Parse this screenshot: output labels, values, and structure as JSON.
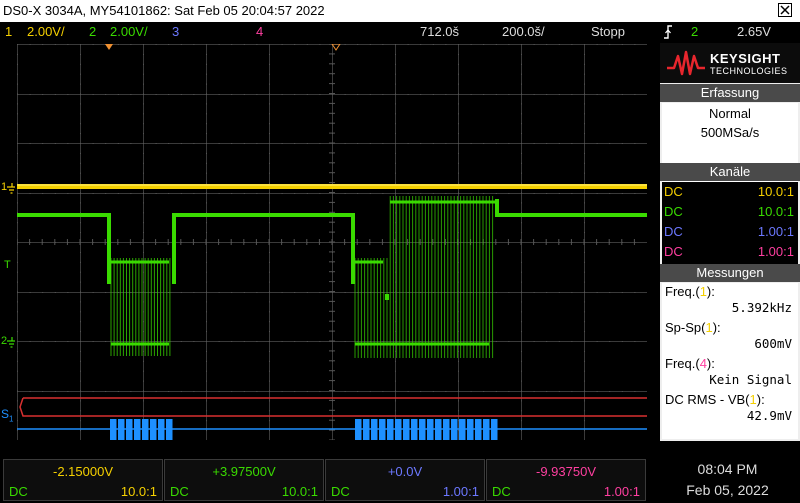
{
  "window": {
    "title": "DS0-X 3034A, MY54101862: Sat Feb 05 20:04:57 2022"
  },
  "status_bar": {
    "ch1_num": "1",
    "ch1_scale": "2.00V/",
    "ch2_num": "2",
    "ch2_scale": "2.00V/",
    "ch3_num": "3",
    "ch4_num": "4",
    "time_delay": "712.0š",
    "time_scale": "200.0š/",
    "run_state": "Stopp",
    "trigger_icon": "trigger-edge-icon",
    "trigger_source": "2",
    "trigger_level": "2.65V"
  },
  "panel": {
    "brand_name": "KEYSIGHT",
    "brand_sub": "TECHNOLOGIES",
    "acquisition_header": "Erfassung",
    "acquisition_mode": "Normal",
    "acquisition_rate": "500MSa/s",
    "channels_header": "Kanäle",
    "channels": [
      {
        "coupling": "DC",
        "probe": "10.0:1",
        "color": "#f5d000"
      },
      {
        "coupling": "DC",
        "probe": "10.0:1",
        "color": "#3adb00"
      },
      {
        "coupling": "DC",
        "probe": "1.00:1",
        "color": "#6c78ff"
      },
      {
        "coupling": "DC",
        "probe": "1.00:1",
        "color": "#ff3fa0"
      }
    ],
    "measurements_header": "Messungen",
    "measurements": [
      {
        "label": "Freq.",
        "src": "1",
        "src_color": "#f5d000",
        "value": "5.392kHz"
      },
      {
        "label": "Sp-Sp",
        "src": "1",
        "src_color": "#f5d000",
        "value": "600mV"
      },
      {
        "label": "Freq.",
        "src": "4",
        "src_color": "#ff3fa0",
        "value": "Kein Signal"
      },
      {
        "label": "DC RMS - VB",
        "src": "1",
        "src_color": "#f5d000",
        "value": "42.9mV"
      }
    ]
  },
  "screen_markers": {
    "ch1_marker": "1",
    "ch2_marker": "2",
    "trigger_marker": "T",
    "serial_marker": "S",
    "serial_marker_sub": "1"
  },
  "bottom": {
    "channels": [
      {
        "offset": "-2.15000V",
        "coupling": "DC",
        "probe": "10.0:1",
        "color": "#f5d000"
      },
      {
        "offset": "+3.97500V",
        "coupling": "DC",
        "probe": "10.0:1",
        "color": "#3adb00"
      },
      {
        "offset": "+0.0V",
        "coupling": "DC",
        "probe": "1.00:1",
        "color": "#6c78ff"
      },
      {
        "offset": "-9.93750V",
        "coupling": "DC",
        "probe": "1.00:1",
        "color": "#ff3fa0"
      }
    ],
    "time": "08:04 PM",
    "date": "Feb 05, 2022"
  },
  "colors": {
    "ch1": "#f5d000",
    "ch2": "#3adb00",
    "ch3": "#6c78ff",
    "ch4": "#ff3fa0",
    "serial": "#1e90ff",
    "serial_bus_red": "#d93030",
    "trigger_marker": "#f09030"
  }
}
